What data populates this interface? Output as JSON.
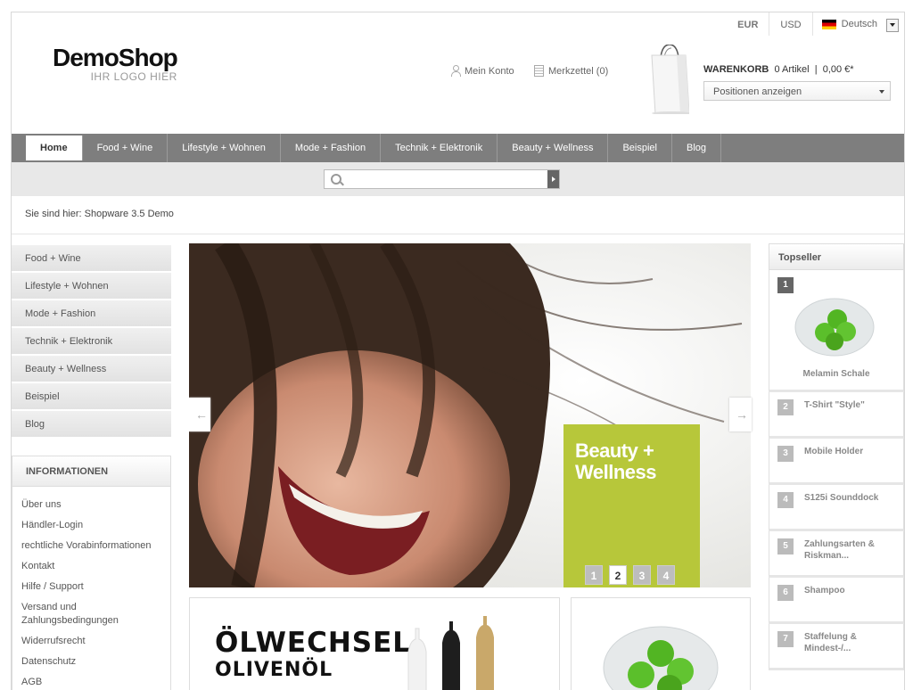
{
  "header": {
    "currencies": [
      "EUR",
      "USD"
    ],
    "language": "Deutsch",
    "logo_main": "DemoShop",
    "logo_sub": "IHR LOGO HIER",
    "account_label": "Mein Konto",
    "wishlist_label": "Merkzettel (0)",
    "cart_title": "WARENKORB",
    "cart_count": "0 Artikel",
    "cart_sep": "|",
    "cart_total": "0,00 €*",
    "cart_select": "Positionen anzeigen"
  },
  "nav": {
    "items": [
      "Home",
      "Food + Wine",
      "Lifestyle + Wohnen",
      "Mode + Fashion",
      "Technik + Elektronik",
      "Beauty + Wellness",
      "Beispiel",
      "Blog"
    ]
  },
  "search": {
    "placeholder": ""
  },
  "breadcrumb": "Sie sind hier: Shopware 3.5 Demo",
  "sidebar": {
    "categories": [
      "Food + Wine",
      "Lifestyle + Wohnen",
      "Mode + Fashion",
      "Technik + Elektronik",
      "Beauty + Wellness",
      "Beispiel",
      "Blog"
    ],
    "info_title": "INFORMATIONEN",
    "info_links": [
      "Über uns",
      "Händler-Login",
      "rechtliche Vorabinformationen",
      "Kontakt",
      "Hilfe / Support",
      "Versand und Zahlungsbedingungen",
      "Widerrufsrecht",
      "Datenschutz",
      "AGB"
    ]
  },
  "slider": {
    "promo_title_line1": "Beauty +",
    "promo_title_line2": "Wellness",
    "pages": [
      "1",
      "2",
      "3",
      "4"
    ],
    "active_page": "2"
  },
  "banners": {
    "banner1_line1": "ÖLWECHSEL",
    "banner1_line2": "OLIVENÖL"
  },
  "topseller": {
    "title": "Topseller",
    "items": [
      {
        "rank": "1",
        "name": "Melamin Schale"
      },
      {
        "rank": "2",
        "name": "T-Shirt \"Style\""
      },
      {
        "rank": "3",
        "name": "Mobile Holder"
      },
      {
        "rank": "4",
        "name": "S125i Sounddock"
      },
      {
        "rank": "5",
        "name": "Zahlungsarten & Riskman..."
      },
      {
        "rank": "6",
        "name": "Shampoo"
      },
      {
        "rank": "7",
        "name": "Staffelung & Mindest-/..."
      }
    ]
  },
  "colors": {
    "nav_bg": "#7e7e7e",
    "promo_green": "#b7c73a",
    "search_bar_bg": "#e8e8e8"
  }
}
